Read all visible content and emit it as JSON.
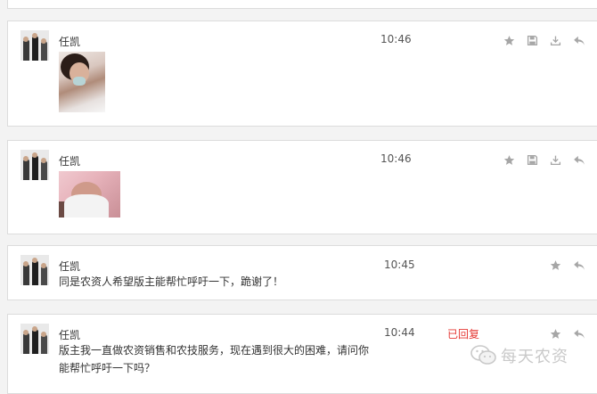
{
  "messages": [
    {
      "id": 1,
      "sender": "任凯",
      "time": "10:46",
      "type": "image",
      "image_desc": "photo-hospital",
      "replied_label": ""
    },
    {
      "id": 2,
      "sender": "任凯",
      "time": "10:46",
      "type": "image",
      "image_desc": "photo-newborn",
      "replied_label": ""
    },
    {
      "id": 3,
      "sender": "任凯",
      "time": "10:45",
      "type": "text",
      "text": "同是农资人希望版主能帮忙呼吁一下，跪谢了！",
      "replied_label": ""
    },
    {
      "id": 4,
      "sender": "任凯",
      "time": "10:44",
      "type": "text",
      "text_line1": "版主我一直做农资销售和农技服务，现在遇到很大的困难，请问你",
      "text_line2": "能帮忙呼吁一下吗？",
      "replied_label": "已回复"
    }
  ],
  "icons": {
    "star": "star-icon",
    "save": "save-icon",
    "download": "download-icon",
    "reply": "reply-icon"
  },
  "watermark": {
    "text": "每天农资"
  },
  "colors": {
    "replied": "#e53935",
    "icon": "#9a9a9a",
    "border": "#dcdcdc",
    "background": "#f3f3f3"
  }
}
